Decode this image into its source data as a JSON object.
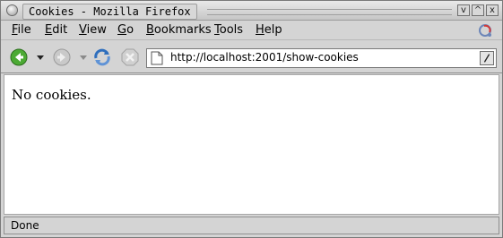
{
  "window": {
    "title": "Cookies - Mozilla Firefox",
    "controls": {
      "minimize": "v",
      "maximize": "^",
      "close": "x"
    }
  },
  "menubar": {
    "items": [
      {
        "label": "File",
        "mnemonic": "F",
        "rest": "ile"
      },
      {
        "label": "Edit",
        "mnemonic": "E",
        "rest": "dit"
      },
      {
        "label": "View",
        "mnemonic": "V",
        "rest": "iew"
      },
      {
        "label": "Go",
        "mnemonic": "G",
        "rest": "o"
      },
      {
        "label": "Bookmarks",
        "mnemonic": "B",
        "rest": "ookmarks"
      },
      {
        "label": "Tools",
        "mnemonic": "T",
        "rest": "ools"
      },
      {
        "label": "Help",
        "mnemonic": "H",
        "rest": "elp"
      }
    ]
  },
  "toolbar": {
    "icons": [
      "back-icon",
      "forward-icon",
      "reload-icon",
      "stop-icon",
      "page-icon",
      "go-icon"
    ],
    "url": "http://localhost:2001/show-cookies",
    "colors": {
      "back_green": "#3a9a2a",
      "reload_blue": "#2f6fbd"
    }
  },
  "content": {
    "text": "No cookies."
  },
  "status": {
    "text": "Done"
  }
}
